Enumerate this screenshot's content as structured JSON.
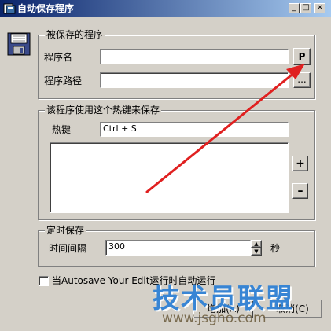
{
  "window": {
    "title": "自动保存程序",
    "minimize_label": "_",
    "maximize_label": "□",
    "close_label": "×"
  },
  "program_group": {
    "title": "被保存的程序",
    "name_label": "程序名",
    "name_value": "",
    "path_label": "程序路径",
    "path_value": "",
    "pick_button": "P",
    "browse_button": "..."
  },
  "hotkey_group": {
    "title": "该程序使用这个热键来保存",
    "hotkey_label": "热键",
    "hotkey_value": "Ctrl + S",
    "add_button": "+",
    "remove_button": "–"
  },
  "timer_group": {
    "title": "定时保存",
    "interval_label": "时间间隔",
    "interval_value": "300",
    "unit_label": "秒"
  },
  "autorun": {
    "label": "当Autosave Your Edit运行时自动运行",
    "checked": false
  },
  "buttons": {
    "add_label": "增加(A)",
    "cancel_label": "取消(C)"
  },
  "watermark": {
    "brand": "技术员联盟",
    "url": "www.jsgho.com"
  },
  "colors": {
    "title_gradient_start": "#0a246a",
    "title_gradient_end": "#a6caf0",
    "annotation_arrow": "#e02020",
    "watermark_brand": "#2b7fd6"
  }
}
